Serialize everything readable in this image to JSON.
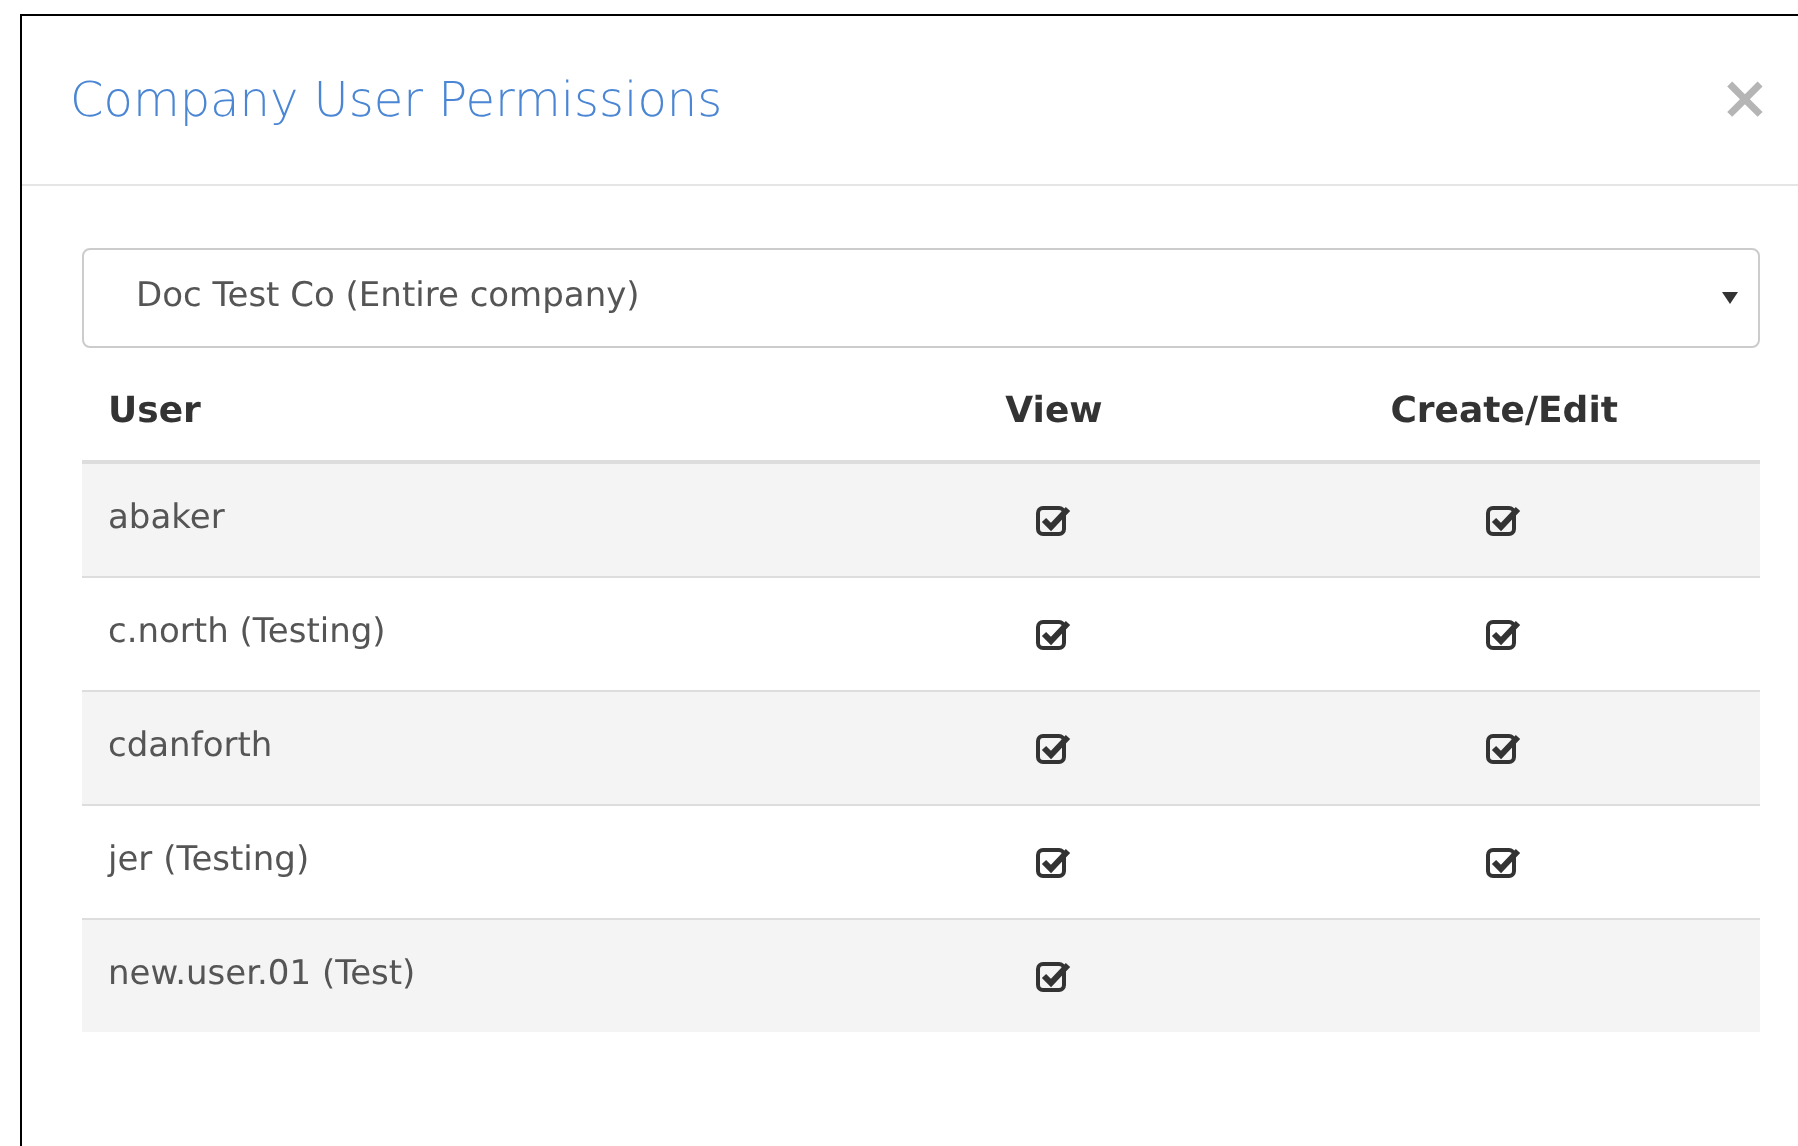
{
  "dialog": {
    "title": "Company User Permissions",
    "close": "×"
  },
  "company_select": {
    "value": "Doc Test Co (Entire company)"
  },
  "table": {
    "columns": [
      "User",
      "View",
      "Create/Edit"
    ],
    "rows": [
      {
        "user": "abaker",
        "view": true,
        "create_edit": true
      },
      {
        "user": "c.north (Testing)",
        "view": true,
        "create_edit": true
      },
      {
        "user": "cdanforth",
        "view": true,
        "create_edit": true
      },
      {
        "user": "jer (Testing)",
        "view": true,
        "create_edit": true
      },
      {
        "user": "new.user.01 (Test)",
        "view": true,
        "create_edit": false
      }
    ]
  }
}
